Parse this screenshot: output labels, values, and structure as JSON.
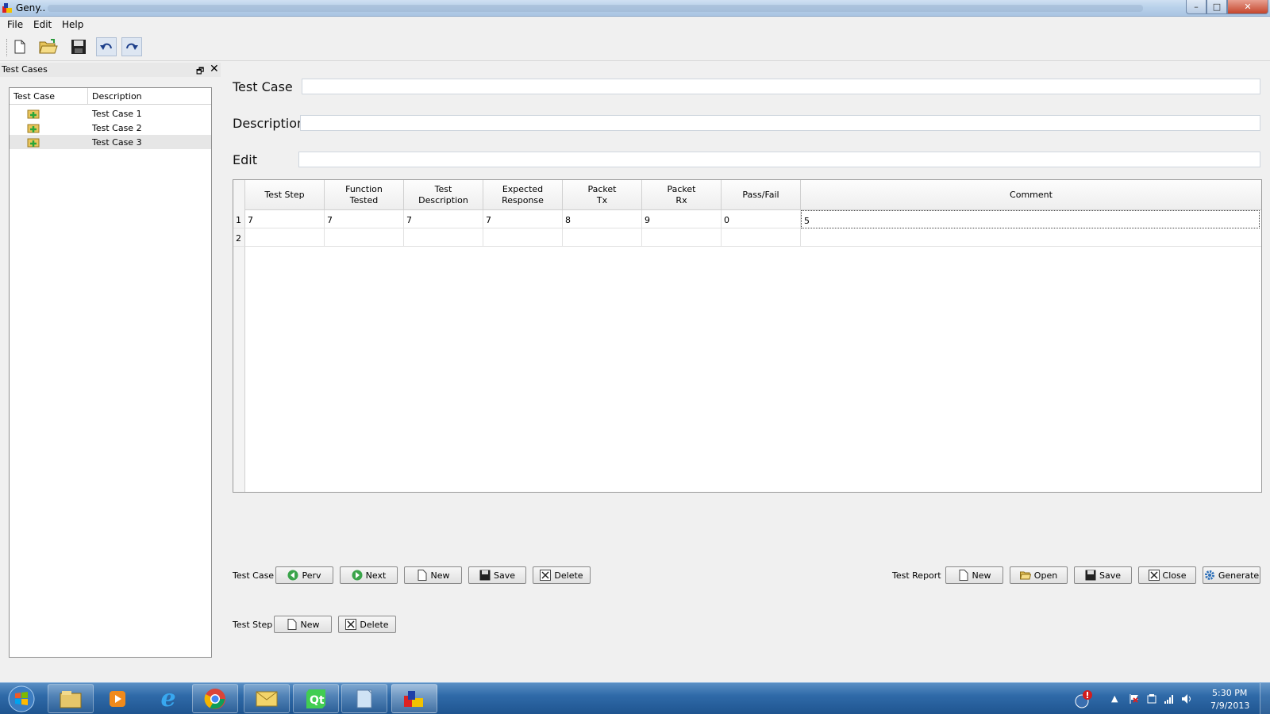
{
  "window": {
    "title": "Geny..",
    "controls": {
      "minimize": "–",
      "maximize": "□",
      "close": "✕"
    }
  },
  "menu": {
    "items": [
      "File",
      "Edit",
      "Help"
    ]
  },
  "toolbar": {
    "buttons": [
      "new-file-icon",
      "open-folder-icon",
      "save-icon",
      "undo-icon",
      "redo-icon"
    ]
  },
  "dock": {
    "title": "Test Cases",
    "float_glyph": "🗗",
    "close_glyph": "✕",
    "columns": [
      "Test Case",
      "Description"
    ],
    "rows": [
      {
        "description": "Test Case 1"
      },
      {
        "description": "Test Case 2"
      },
      {
        "description": "Test Case 3"
      }
    ],
    "selected_index": 2
  },
  "form": {
    "test_case_label": "Test Case",
    "description_label": "Description",
    "edit_label": "Edit",
    "test_case_value": "",
    "description_value": "",
    "edit_value": ""
  },
  "table": {
    "columns": [
      "Test Step",
      "Function\nTested",
      "Test\nDescription",
      "Expected\nResponse",
      "Packet\nTx",
      "Packet\nRx",
      "Pass/Fail",
      "Comment"
    ],
    "row_numbers": [
      "1",
      "2"
    ],
    "rows": [
      [
        "7",
        "7",
        "7",
        "7",
        "8",
        "9",
        "0",
        "5"
      ],
      [
        "",
        "",
        "",
        "",
        "",
        "",
        "",
        ""
      ]
    ]
  },
  "test_case_group": {
    "label": "Test Case",
    "buttons": {
      "prev": "Perv",
      "next": "Next",
      "new": "New",
      "save": "Save",
      "delete": "Delete"
    }
  },
  "test_step_group": {
    "label": "Test Step",
    "buttons": {
      "new": "New",
      "delete": "Delete"
    }
  },
  "test_report_group": {
    "label": "Test  Report",
    "buttons": {
      "new": "New",
      "open": "Open",
      "save": "Save",
      "close": "Close",
      "generate": "Generate"
    }
  },
  "taskbar": {
    "apps": [
      "explorer-icon",
      "media-player-icon",
      "internet-explorer-icon",
      "chrome-icon",
      "outlook-icon",
      "qt-creator-icon",
      "notepad-icon",
      "geny-app-icon"
    ],
    "clock_time": "5:30 PM",
    "clock_date": "7/9/2013"
  },
  "colors": {
    "taskbar": "#2f6aa8",
    "titlebar": "#b9d1ea",
    "close_button": "#c4452c"
  }
}
